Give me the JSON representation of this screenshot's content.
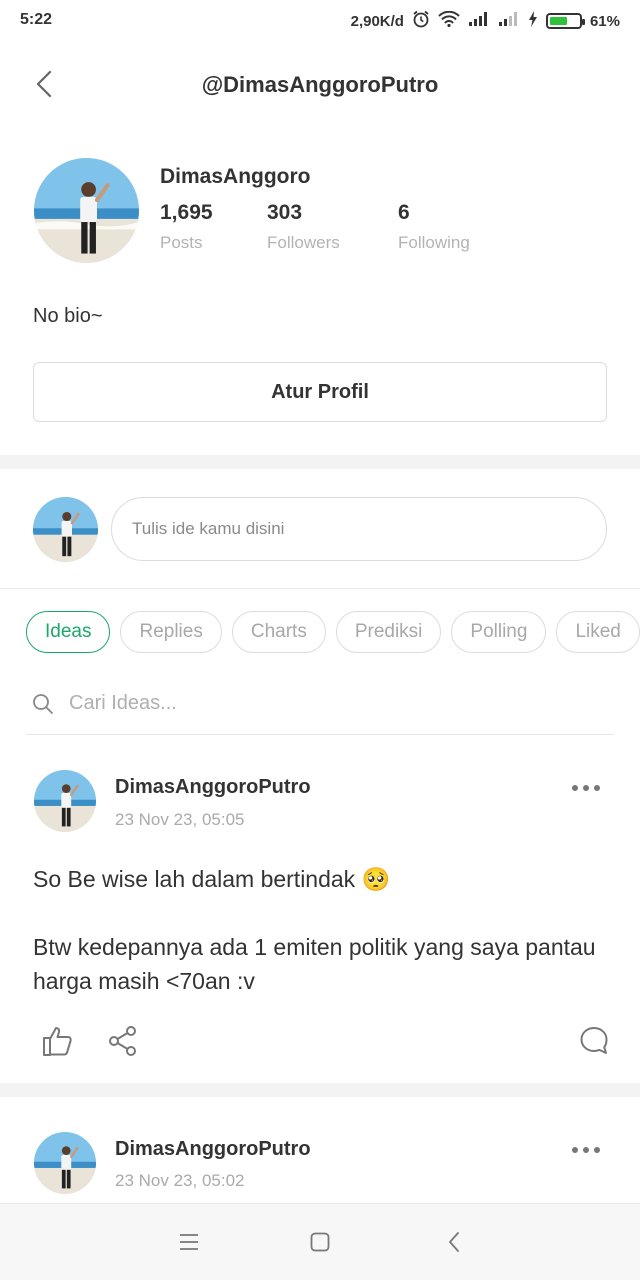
{
  "status_bar": {
    "time": "5:22",
    "network_speed": "2,90K/d",
    "battery_percent": "61%",
    "battery_level": 0.61,
    "icons": [
      "alarm-icon",
      "wifi-icon",
      "signal-icon",
      "signal-weak-icon",
      "charging-icon",
      "battery-icon"
    ]
  },
  "header": {
    "title": "@DimasAnggoroPutro",
    "back_icon": "chevron-left-icon"
  },
  "profile": {
    "name": "DimasAnggoro",
    "stats": [
      {
        "value": "1,695",
        "label": "Posts"
      },
      {
        "value": "303",
        "label": "Followers"
      },
      {
        "value": "6",
        "label": "Following"
      }
    ],
    "bio": "No bio~",
    "edit_button": "Atur Profil"
  },
  "composer": {
    "placeholder": "Tulis ide kamu disini"
  },
  "tabs": [
    {
      "label": "Ideas",
      "active": true
    },
    {
      "label": "Replies",
      "active": false
    },
    {
      "label": "Charts",
      "active": false
    },
    {
      "label": "Prediksi",
      "active": false
    },
    {
      "label": "Polling",
      "active": false
    },
    {
      "label": "Liked",
      "active": false
    }
  ],
  "search": {
    "placeholder": "Cari Ideas..."
  },
  "posts": [
    {
      "author": "DimasAnggoroPutro",
      "time": "23 Nov 23, 05:05",
      "line1": "So Be wise lah dalam bertindak 🥺",
      "line2": "Btw kedepannya ada 1 emiten politik yang saya pantau harga masih <70an :v"
    },
    {
      "author": "DimasAnggoroPutro",
      "time": "23 Nov 23, 05:02"
    }
  ],
  "colors": {
    "accent": "#1aa86b",
    "battery": "#2ec23a"
  }
}
